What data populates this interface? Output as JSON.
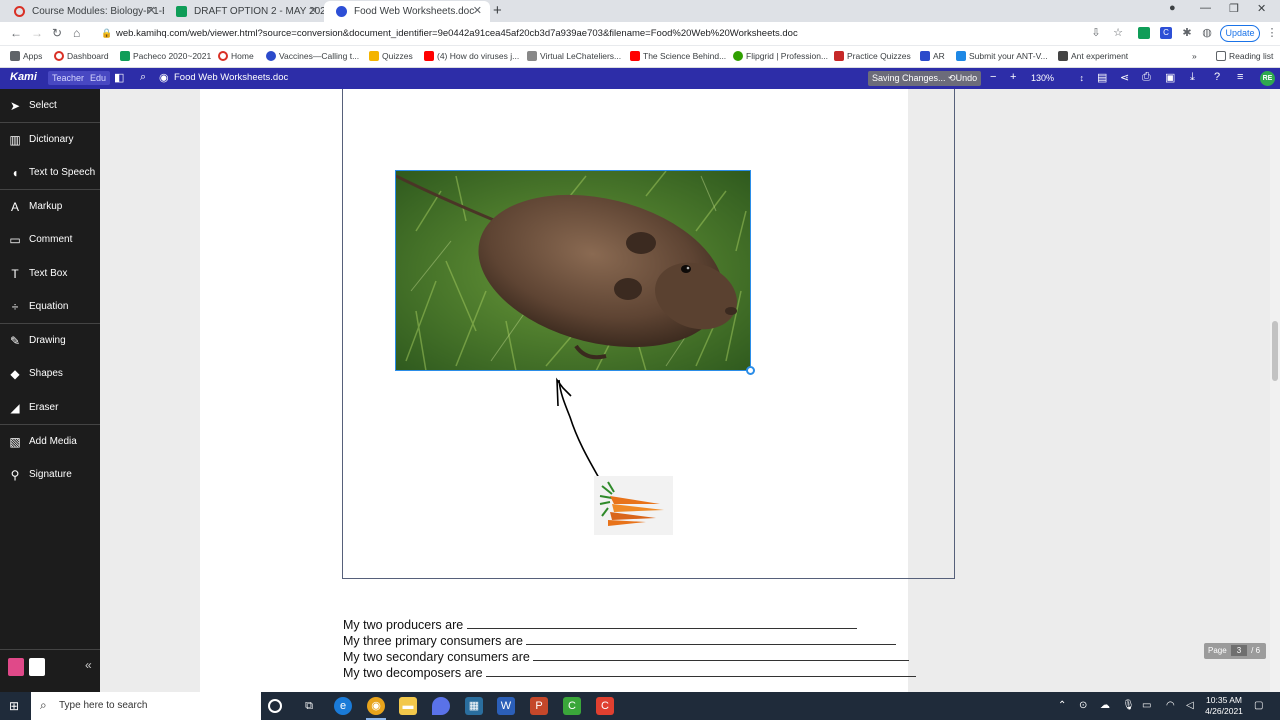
{
  "browser": {
    "tabs": [
      {
        "title": "Course Modules: Biology-P1-Ek",
        "active": false,
        "color": "#d93025"
      },
      {
        "title": "DRAFT OPTION 2 - MAY 2021- M",
        "active": false,
        "color": "#0f9d58"
      },
      {
        "title": "Food Web Worksheets.doc",
        "active": true,
        "color": "#2d4fd6"
      }
    ],
    "url": "web.kamihq.com/web/viewer.html?source=conversion&document_identifier=9e0442a91cea45af20cb3d7a939ae703&filename=Food%20Web%20Worksheets.doc",
    "update_label": "Update",
    "bookmarks": [
      {
        "label": "Apps",
        "color": "#5f6368"
      },
      {
        "label": "Dashboard",
        "color": "#d93025"
      },
      {
        "label": "Pacheco 2020~2021",
        "color": "#0f9d58"
      },
      {
        "label": "Home",
        "color": "#d93025"
      },
      {
        "label": "Vaccines—Calling t...",
        "color": "#2b4acb"
      },
      {
        "label": "Quizzes",
        "color": "#f4b400"
      },
      {
        "label": "(4) How do viruses j...",
        "color": "#ff0000"
      },
      {
        "label": "Virtual LeChateliers...",
        "color": "#888888"
      },
      {
        "label": "The Science Behind...",
        "color": "#ff0000"
      },
      {
        "label": "Flipgrid | Profession...",
        "color": "#30a000"
      },
      {
        "label": "Practice Quizzes",
        "color": "#c62828"
      },
      {
        "label": "AR",
        "color": "#2b4acb"
      },
      {
        "label": "Submit your ANT-V...",
        "color": "#1e88e5"
      },
      {
        "label": "Ant experiment",
        "color": "#444444"
      }
    ],
    "reading_list": "Reading list"
  },
  "kami": {
    "logo": "Kami",
    "badge_teacher": "Teacher",
    "badge_edu": "Edu",
    "doc_title": "Food Web Worksheets.doc",
    "saving": "Saving Changes...",
    "undo": "Undo",
    "zoom": "130%",
    "avatar": "RE",
    "brand_color": "#2d2da8"
  },
  "sidebar": {
    "items": [
      {
        "label": "Select",
        "icon": "cursor-icon"
      },
      {
        "label": "Dictionary",
        "icon": "book-icon"
      },
      {
        "label": "Text to Speech",
        "icon": "speaker-icon"
      },
      {
        "label": "Markup",
        "icon": "markup-icon"
      },
      {
        "label": "Comment",
        "icon": "comment-icon"
      },
      {
        "label": "Text Box",
        "icon": "text-icon"
      },
      {
        "label": "Equation",
        "icon": "equation-icon"
      },
      {
        "label": "Drawing",
        "icon": "pencil-icon"
      },
      {
        "label": "Shapes",
        "icon": "shapes-icon"
      },
      {
        "label": "Eraser",
        "icon": "eraser-icon"
      },
      {
        "label": "Add Media",
        "icon": "media-icon"
      },
      {
        "label": "Signature",
        "icon": "signature-icon"
      }
    ]
  },
  "document": {
    "questions": [
      "My two producers are",
      "My three primary consumers are",
      "My two secondary consumers are",
      "My two decomposers are"
    ],
    "page_label": "Page",
    "page_current": "3",
    "page_total": "/ 6"
  },
  "taskbar": {
    "search_placeholder": "Type here to search",
    "time": "10:35 AM",
    "date": "4/26/2021"
  }
}
